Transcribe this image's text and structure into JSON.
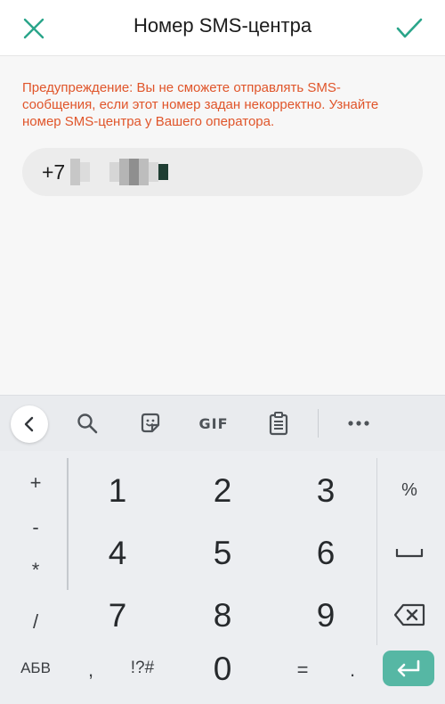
{
  "header": {
    "title": "Номер SMS-центра"
  },
  "content": {
    "warning": "Предупреждение: Вы не сможете отправлять SMS-сообщения, если этот номер задан некорректно. Узнайте номер SMS-центра у Вашего оператора.",
    "field_prefix": "+7"
  },
  "toolbar": {
    "gif_label": "GIF"
  },
  "keyboard": {
    "left_keys": [
      "+",
      "-",
      "*",
      "/"
    ],
    "digits": [
      "1",
      "2",
      "3",
      "4",
      "5",
      "6",
      "7",
      "8",
      "9",
      "0"
    ],
    "right_keys": [
      "%"
    ],
    "bottom": {
      "abc_label": "АБВ",
      "comma": ",",
      "symbols_label": "!?#",
      "equals": "=",
      "dot": "."
    }
  },
  "colors": {
    "accent": "#2aa58a",
    "warning": "#e0552a",
    "enter_key": "#56b7a4"
  }
}
